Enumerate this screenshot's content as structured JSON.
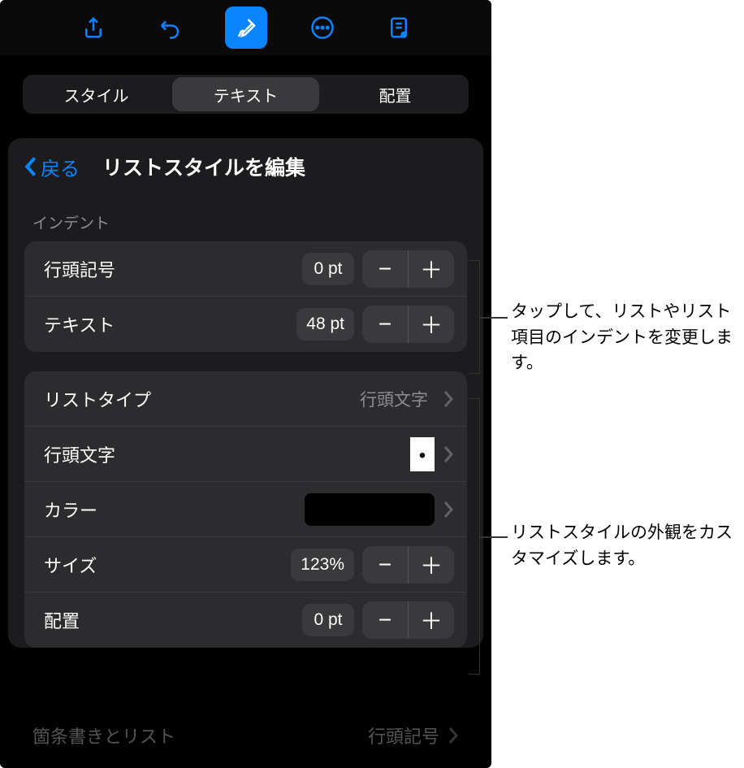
{
  "toolbar": {
    "icons": [
      "share-icon",
      "undo-icon",
      "format-brush-icon",
      "more-icon",
      "document-view-icon"
    ]
  },
  "segmented": {
    "items": [
      "スタイル",
      "テキスト",
      "配置"
    ],
    "selected": 1
  },
  "panel": {
    "back_label": "戻る",
    "title": "リストスタイルを編集"
  },
  "indent": {
    "section_label": "インデント",
    "bullet_label": "行頭記号",
    "bullet_value": "0 pt",
    "text_label": "テキスト",
    "text_value": "48 pt"
  },
  "appearance": {
    "list_type_label": "リストタイプ",
    "list_type_value": "行頭文字",
    "bullet_char_label": "行頭文字",
    "bullet_char_value": "•",
    "color_label": "カラー",
    "color_value": "#000000",
    "size_label": "サイズ",
    "size_value": "123%",
    "align_label": "配置",
    "align_value": "0 pt"
  },
  "bottom": {
    "label": "箇条書きとリスト",
    "value": "行頭記号"
  },
  "annotations": {
    "a1": "タップして、リストやリスト項目のインデントを変更します。",
    "a2": "リストスタイルの外観をカスタマイズします。"
  }
}
